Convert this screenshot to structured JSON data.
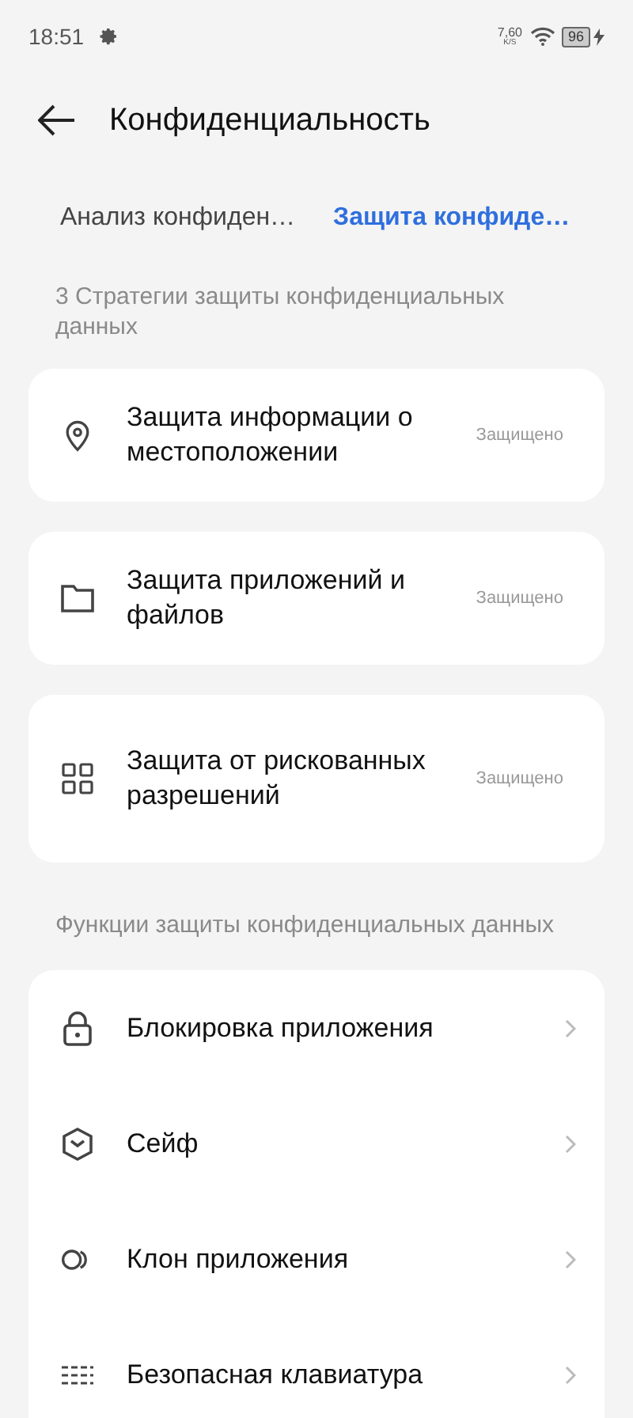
{
  "status_bar": {
    "time": "18:51",
    "net_speed": "7,60",
    "net_unit": "K/S",
    "battery": "96"
  },
  "header": {
    "title": "Конфиденциальность"
  },
  "tabs": [
    {
      "label": "Анализ конфиден…",
      "selected": false
    },
    {
      "label": "Защита конфиде…",
      "selected": true
    }
  ],
  "strategies": {
    "heading": "3 Стратегии защиты конфиденциальных данных",
    "items": [
      {
        "label": "Защита информации о местоположении",
        "status": "Защищено"
      },
      {
        "label": "Защита приложений и файлов",
        "status": "Защищено"
      },
      {
        "label": "Защита от рискованных разрешений",
        "status": "Защищено"
      }
    ]
  },
  "functions": {
    "heading": "Функции защиты конфиденциальных данных",
    "items": [
      {
        "label": "Блокировка приложения"
      },
      {
        "label": "Сейф"
      },
      {
        "label": "Клон приложения"
      },
      {
        "label": "Безопасная клавиатура"
      }
    ]
  }
}
